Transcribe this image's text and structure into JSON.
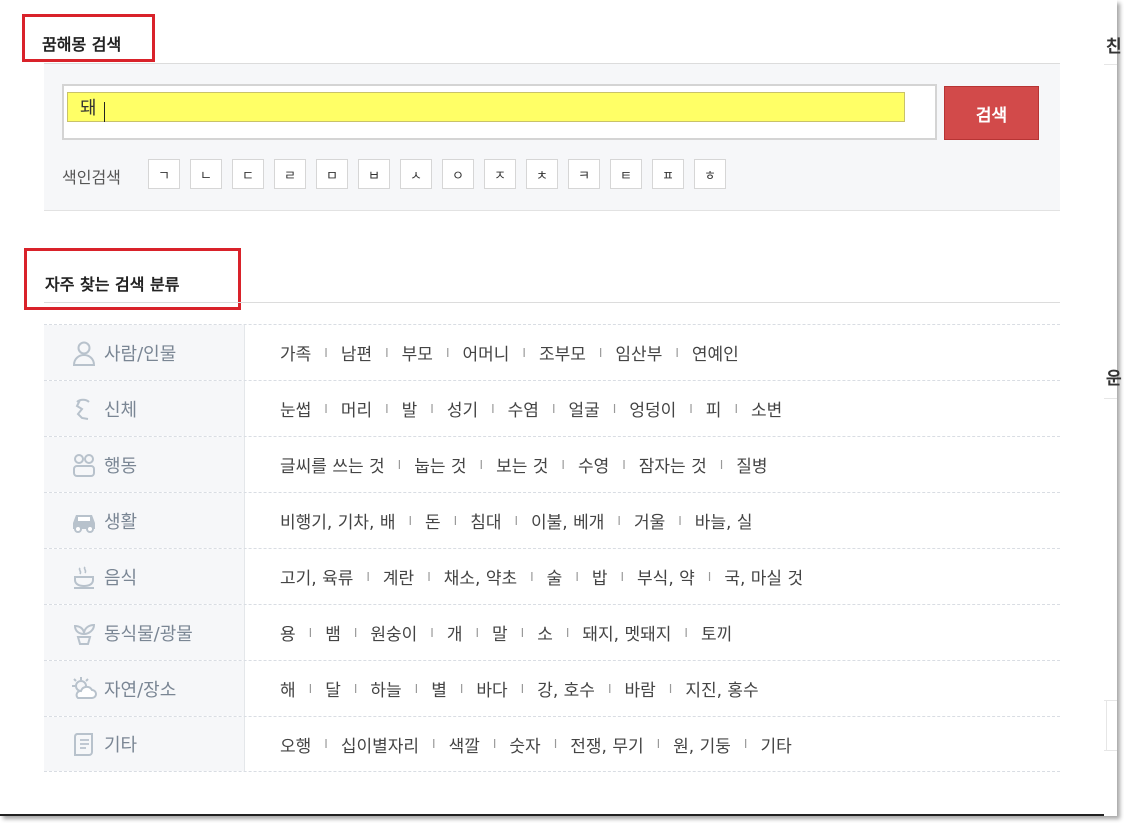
{
  "search": {
    "title": "꿈해몽 검색",
    "input_value": "돼",
    "button_label": "검색",
    "index_label": "색인검색",
    "index_keys": [
      "ㄱ",
      "ㄴ",
      "ㄷ",
      "ㄹ",
      "ㅁ",
      "ㅂ",
      "ㅅ",
      "ㅇ",
      "ㅈ",
      "ㅊ",
      "ㅋ",
      "ㅌ",
      "ㅍ",
      "ㅎ"
    ]
  },
  "categories": {
    "title": "자주 찾는 검색 분류",
    "rows": [
      {
        "name": "사람/인물",
        "icon": "person-icon",
        "items": [
          "가족",
          "남편",
          "부모",
          "어머니",
          "조부모",
          "임산부",
          "연예인"
        ]
      },
      {
        "name": "신체",
        "icon": "body-icon",
        "items": [
          "눈썹",
          "머리",
          "발",
          "성기",
          "수염",
          "얼굴",
          "엉덩이",
          "피",
          "소변"
        ]
      },
      {
        "name": "행동",
        "icon": "action-icon",
        "items": [
          "글씨를 쓰는 것",
          "눕는 것",
          "보는 것",
          "수영",
          "잠자는 것",
          "질병"
        ]
      },
      {
        "name": "생활",
        "icon": "car-icon",
        "items": [
          "비행기, 기차, 배",
          "돈",
          "침대",
          "이불, 베개",
          "거울",
          "바늘, 실"
        ]
      },
      {
        "name": "음식",
        "icon": "food-icon",
        "items": [
          "고기, 육류",
          "계란",
          "채소, 약초",
          "술",
          "밥",
          "부식, 약",
          "국, 마실 것"
        ]
      },
      {
        "name": "동식물/광물",
        "icon": "plant-icon",
        "items": [
          "용",
          "뱀",
          "원숭이",
          "개",
          "말",
          "소",
          "돼지, 멧돼지",
          "토끼"
        ]
      },
      {
        "name": "자연/장소",
        "icon": "weather-icon",
        "items": [
          "해",
          "달",
          "하늘",
          "별",
          "바다",
          "강, 호수",
          "바람",
          "지진, 홍수"
        ]
      },
      {
        "name": "기타",
        "icon": "scroll-icon",
        "items": [
          "오행",
          "십이별자리",
          "색깔",
          "숫자",
          "전쟁, 무기",
          "원, 기둥",
          "기타"
        ]
      }
    ]
  },
  "right_edge": {
    "glyph_top": "친",
    "glyph_mid": "운"
  },
  "colors": {
    "highlight": "#ffff66",
    "button": "#d24a4a",
    "annotation": "#d9222a",
    "category_text": "#7a8694"
  }
}
